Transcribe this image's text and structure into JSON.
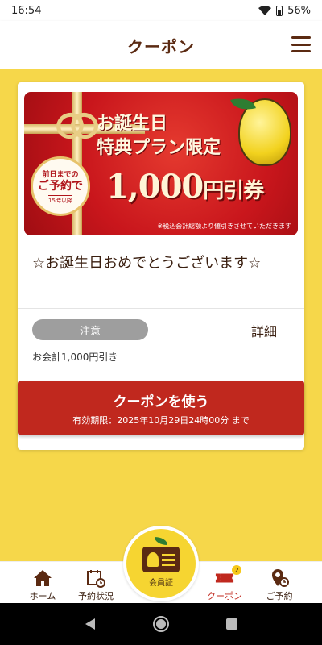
{
  "status_bar": {
    "time": "16:54",
    "battery": "56%"
  },
  "header": {
    "title": "クーポン"
  },
  "coupon": {
    "banner": {
      "title_line1": "お誕生日",
      "title_line2": "特典プラン限定",
      "badge_line1": "前日までの",
      "badge_line2": "ご予約で",
      "badge_line3": "15時以降",
      "amount": "1,000",
      "amount_suffix": "円引券",
      "note": "※税込会計総額より値引きさせていただきます"
    },
    "title": "☆お誕生日おめでとうございます☆",
    "notice_label": "注意",
    "detail_label": "詳細",
    "description": "お会計1,000円引き",
    "use_button_label": "クーポンを使う",
    "expiry": "有効期限：2025年10月29日24時00分 まで"
  },
  "bottom_nav": {
    "home": "ホーム",
    "reservation_status": "予約状況",
    "member_card": "会員証",
    "coupon": "クーポン",
    "coupon_badge": "2",
    "reserve": "ご予約"
  },
  "colors": {
    "accent": "#c0281e",
    "brand_brown": "#5b2a12",
    "background_yellow": "#f6d74a"
  }
}
